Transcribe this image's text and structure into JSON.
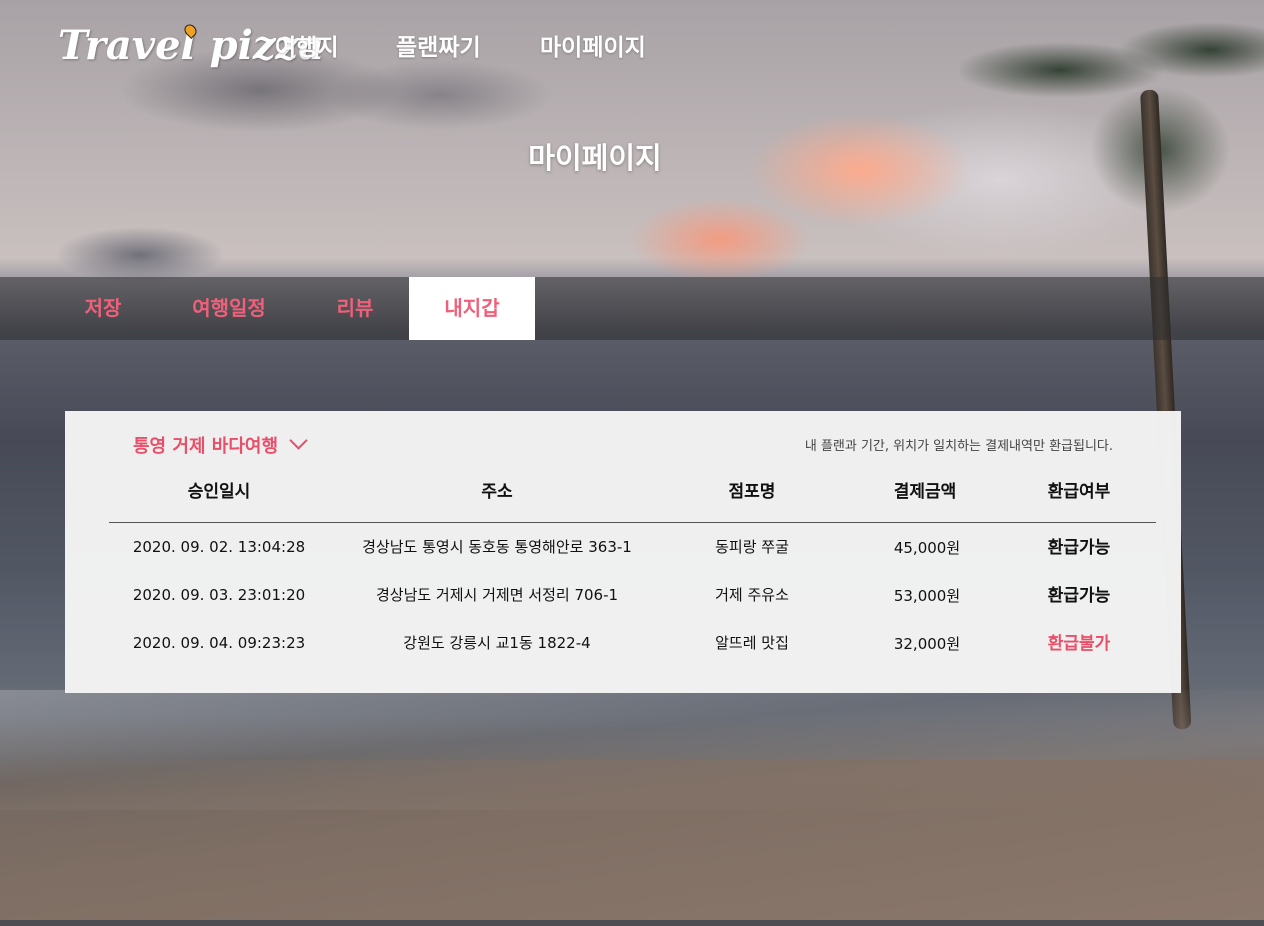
{
  "brand": {
    "logo_text": "Travel pizza"
  },
  "nav": {
    "items": [
      {
        "label": "여행지"
      },
      {
        "label": "플랜짜기"
      },
      {
        "label": "마이페이지"
      }
    ]
  },
  "page": {
    "title": "마이페이지"
  },
  "tabs": [
    {
      "label": "저장",
      "active": false
    },
    {
      "label": "여행일정",
      "active": false
    },
    {
      "label": "리뷰",
      "active": false
    },
    {
      "label": "내지갑",
      "active": true
    }
  ],
  "wallet": {
    "trip_select": {
      "value": "통영 거제 바다여행",
      "icon": "chevron-down-icon"
    },
    "notice": "내 플랜과 기간, 위치가 일치하는 결제내역만 환급됩니다.",
    "columns": [
      "승인일시",
      "주소",
      "점포명",
      "결제금액",
      "환급여부"
    ],
    "rows": [
      {
        "date": "2020. 09. 02. 13:04:28",
        "address": "경상남도 통영시 동호동 통영해안로 363-1",
        "store": "동피랑 쭈굴",
        "amount": "45,000원",
        "refund": "환급가능"
      },
      {
        "date": "2020. 09. 03. 23:01:20",
        "address": "경상남도 거제시 거제면 서정리 706-1",
        "store": "거제 주유소",
        "amount": "53,000원",
        "refund": "환급가능"
      },
      {
        "date": "2020. 09. 04. 09:23:23",
        "address": "강원도 강릉시 교1동 1822-4",
        "store": "알뜨레 맛집",
        "amount": "32,000원",
        "refund": "환급불가"
      }
    ]
  },
  "colors": {
    "accent": "#e8506a",
    "tab_text": "#f0607a",
    "panel_bg": "#f5f5f5"
  }
}
